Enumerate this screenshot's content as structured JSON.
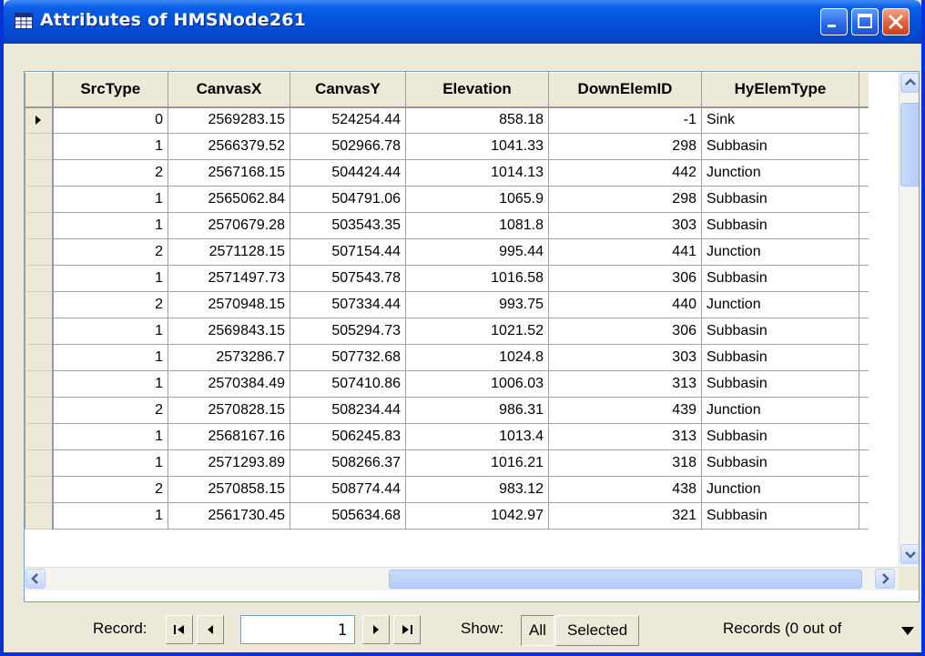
{
  "window": {
    "title": "Attributes of HMSNode261"
  },
  "table": {
    "columns": [
      "SrcType",
      "CanvasX",
      "CanvasY",
      "Elevation",
      "DownElemID",
      "HyElemType"
    ],
    "rows": [
      [
        "0",
        "2569283.15",
        "524254.44",
        "858.18",
        "-1",
        "Sink"
      ],
      [
        "1",
        "2566379.52",
        "502966.78",
        "1041.33",
        "298",
        "Subbasin"
      ],
      [
        "2",
        "2567168.15",
        "504424.44",
        "1014.13",
        "442",
        "Junction"
      ],
      [
        "1",
        "2565062.84",
        "504791.06",
        "1065.9",
        "298",
        "Subbasin"
      ],
      [
        "1",
        "2570679.28",
        "503543.35",
        "1081.8",
        "303",
        "Subbasin"
      ],
      [
        "2",
        "2571128.15",
        "507154.44",
        "995.44",
        "441",
        "Junction"
      ],
      [
        "1",
        "2571497.73",
        "507543.78",
        "1016.58",
        "306",
        "Subbasin"
      ],
      [
        "2",
        "2570948.15",
        "507334.44",
        "993.75",
        "440",
        "Junction"
      ],
      [
        "1",
        "2569843.15",
        "505294.73",
        "1021.52",
        "306",
        "Subbasin"
      ],
      [
        "1",
        "2573286.7",
        "507732.68",
        "1024.8",
        "303",
        "Subbasin"
      ],
      [
        "1",
        "2570384.49",
        "507410.86",
        "1006.03",
        "313",
        "Subbasin"
      ],
      [
        "2",
        "2570828.15",
        "508234.44",
        "986.31",
        "439",
        "Junction"
      ],
      [
        "1",
        "2568167.16",
        "506245.83",
        "1013.4",
        "313",
        "Subbasin"
      ],
      [
        "1",
        "2571293.89",
        "508266.37",
        "1016.21",
        "318",
        "Subbasin"
      ],
      [
        "2",
        "2570858.15",
        "508774.44",
        "983.12",
        "438",
        "Junction"
      ],
      [
        "1",
        "2561730.45",
        "505634.68",
        "1042.97",
        "321",
        "Subbasin"
      ]
    ]
  },
  "navigation": {
    "record_label": "Record:",
    "record_value": "1",
    "show_label": "Show:",
    "all_label": "All",
    "selected_label": "Selected",
    "records_text": "Records (0 out of"
  },
  "icons": {
    "title": "table-icon",
    "first": "first-record-icon",
    "prev": "previous-record-icon",
    "next": "next-record-icon",
    "last": "last-record-icon",
    "options": "options-dropdown-icon"
  },
  "colors": {
    "title_bar": "#0551dc",
    "close_button": "#e35f3a",
    "chrome": "#ece9d8"
  }
}
